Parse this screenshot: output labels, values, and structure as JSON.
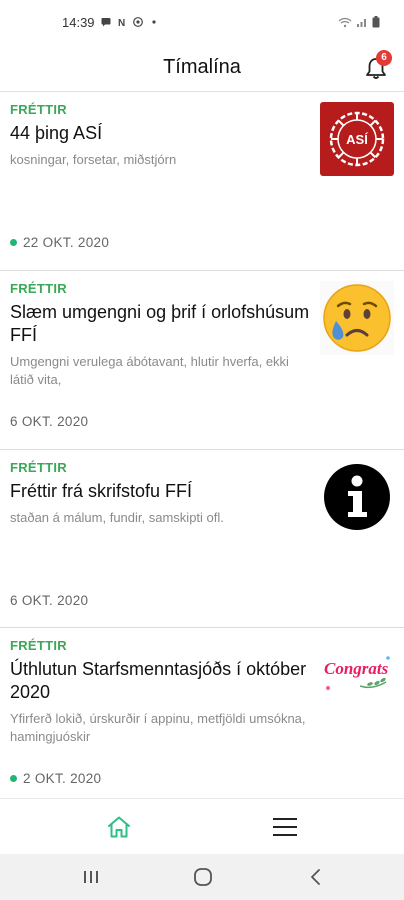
{
  "status_bar": {
    "time": "14:39"
  },
  "header": {
    "title": "Tímalína",
    "notification_count": "6"
  },
  "feed": [
    {
      "category": "FRÉTTIR",
      "title": "44 þing ASÍ",
      "tags": "kosningar, forsetar, miðstjórn",
      "date": "22 OKT. 2020",
      "unread": true,
      "thumb_text": "ASÍ"
    },
    {
      "category": "FRÉTTIR",
      "title": "Slæm umgengni og þrif í orlofshúsum FFÍ",
      "tags": "Umgengni verulega ábótavant, hlutir hverfa, ekki látið vita,",
      "date": "6 OKT. 2020",
      "unread": false
    },
    {
      "category": "FRÉTTIR",
      "title": "Fréttir frá skrifstofu FFÍ",
      "tags": "staðan á málum, fundir, samskipti ofl.",
      "date": "6 OKT. 2020",
      "unread": false
    },
    {
      "category": "FRÉTTIR",
      "title": "Úthlutun Starfsmenntasjóðs í október 2020",
      "tags": "Yfirferð lokið, úrskurðir í appinu, metfjöldi umsókna, hamingjuóskir",
      "date": "2 OKT. 2020",
      "unread": true,
      "thumb_text": "Congrats"
    }
  ],
  "colors": {
    "accent": "#3aa857",
    "unread_dot": "#22b573",
    "badge": "#e53935",
    "asi_red": "#b71c1c"
  }
}
